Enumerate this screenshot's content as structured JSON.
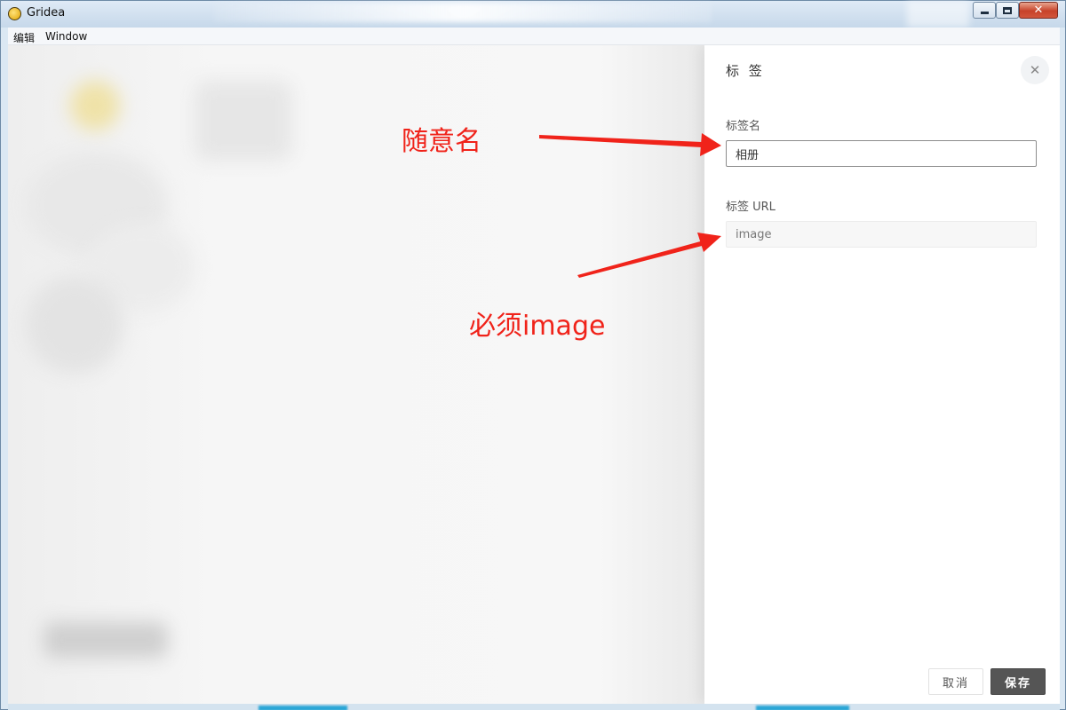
{
  "window": {
    "title": "Gridea",
    "icon": "gridea-app-icon"
  },
  "menubar": {
    "items": [
      "编辑",
      "Window"
    ]
  },
  "drawer": {
    "title": "标 签",
    "close_icon": "close-icon",
    "fields": [
      {
        "label": "标签名",
        "value": "相册",
        "placeholder": ""
      },
      {
        "label": "标签 URL",
        "value": "image",
        "placeholder": ""
      }
    ],
    "buttons": {
      "cancel": "取消",
      "save": "保存"
    }
  },
  "annotations": [
    {
      "text": "随意名",
      "color": "#f0231a"
    },
    {
      "text": "必须image",
      "color": "#f0231a"
    }
  ]
}
